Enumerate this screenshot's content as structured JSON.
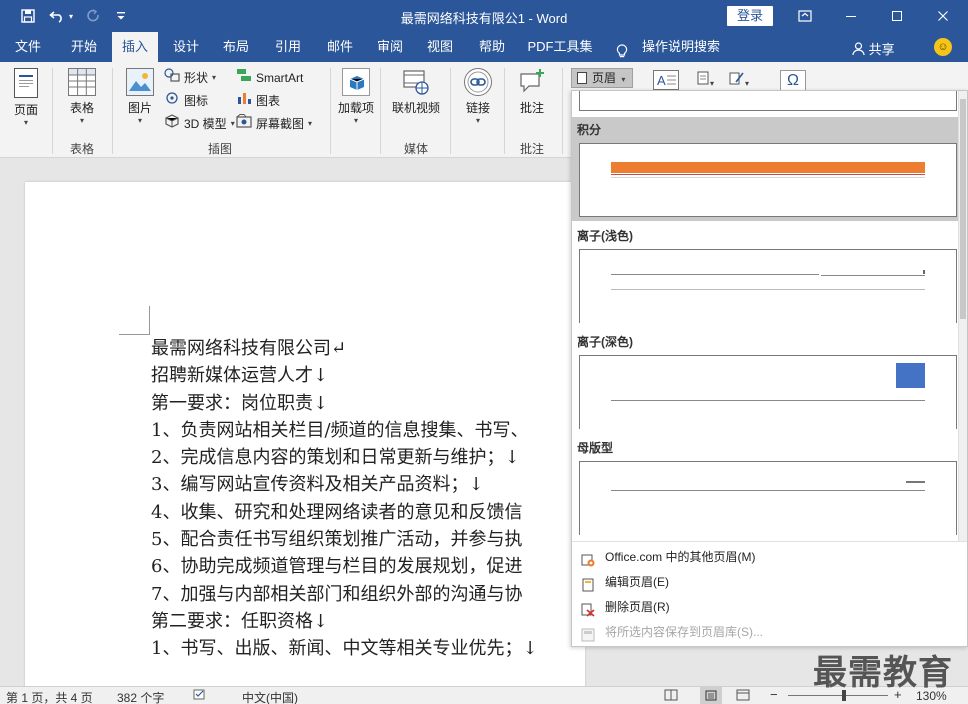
{
  "titlebar": {
    "title": "最需网络科技有限公1 - Word",
    "login_label": "登录",
    "icons": {
      "save": "save-icon",
      "undo": "undo-icon",
      "redo": "redo-icon",
      "customize": "customize-qat-icon",
      "ribbon_display": "ribbon-display-icon",
      "minimize": "minimize-icon",
      "maximize": "maximize-icon",
      "close": "close-icon"
    }
  },
  "menu": {
    "tabs": [
      "文件",
      "开始",
      "插入",
      "设计",
      "布局",
      "引用",
      "邮件",
      "审阅",
      "视图",
      "帮助",
      "PDF工具集",
      "操作说明搜索"
    ],
    "active": "插入",
    "share_label": "共享"
  },
  "ribbon": {
    "page_label": "页面",
    "table_label": "表格",
    "table_group": "表格",
    "picture_label": "图片",
    "shapes_label": "形状",
    "icons_label": "图标",
    "model3d_label": "3D 模型",
    "smartart_label": "SmartArt",
    "chart_label": "图表",
    "screenshot_label": "屏幕截图",
    "illustrations_group": "插图",
    "addins_label": "加载项",
    "online_video_label": "联机视频",
    "media_group": "媒体",
    "link_label": "链接",
    "comment_label": "批注",
    "comment_group": "批注",
    "header_label": "页眉"
  },
  "gallery": {
    "sections": [
      {
        "title": "积分",
        "selected": true
      },
      {
        "title": "离子(浅色)",
        "selected": false
      },
      {
        "title": "离子(深色)",
        "selected": false
      },
      {
        "title": "母版型",
        "selected": false
      }
    ],
    "footer": [
      {
        "label": "Office.com 中的其他页眉(M)",
        "enabled": true,
        "icon": "office-icon"
      },
      {
        "label": "编辑页眉(E)",
        "enabled": true,
        "icon": "edit-header-icon"
      },
      {
        "label": "删除页眉(R)",
        "enabled": true,
        "icon": "delete-header-icon"
      },
      {
        "label": "将所选内容保存到页眉库(S)...",
        "enabled": false,
        "icon": "save-to-gallery-icon"
      }
    ]
  },
  "document": {
    "lines": [
      "最需网络科技有限公司↵",
      "招聘新媒体运营人才↓",
      "第一要求：岗位职责↓",
      "1、负责网站相关栏目/频道的信息搜集、书写、",
      "2、完成信息内容的策划和日常更新与维护；↓",
      "3、编写网站宣传资料及相关产品资料；↓",
      "4、收集、研究和处理网络读者的意见和反馈信",
      "5、配合责任书写组织策划推广活动，并参与执",
      "6、协助完成频道管理与栏目的发展规划，促进",
      "7、加强与内部相关部门和组织外部的沟通与协",
      "第二要求：任职资格↓",
      "1、书写、出版、新闻、中文等相关专业优先；↓"
    ]
  },
  "status": {
    "page": "第 1 页，共 4 页",
    "words": "382 个字",
    "language": "中文(中国)",
    "zoom": "130%"
  },
  "watermark": "最需教育",
  "colors": {
    "titlebar": "#2b579a",
    "integral_bar": "#ed7d31",
    "ion_dark_box": "#4472c4"
  }
}
